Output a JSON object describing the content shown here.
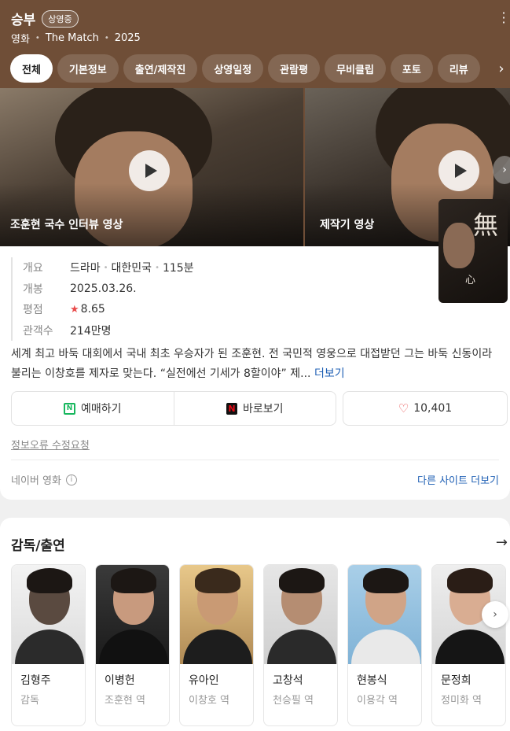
{
  "header": {
    "title": "승부",
    "badge": "상영중",
    "meta": [
      "영화",
      "The Match",
      "2025"
    ],
    "bg_color": "#6f4e37"
  },
  "tabs": [
    {
      "label": "전체",
      "active": true
    },
    {
      "label": "기본정보",
      "active": false
    },
    {
      "label": "출연/제작진",
      "active": false
    },
    {
      "label": "상영일정",
      "active": false
    },
    {
      "label": "관람평",
      "active": false
    },
    {
      "label": "무비클립",
      "active": false
    },
    {
      "label": "포토",
      "active": false
    },
    {
      "label": "리뷰",
      "active": false
    }
  ],
  "videos": [
    {
      "caption": "조훈현 국수 인터뷰 영상",
      "icon": "play-icon"
    },
    {
      "caption": "제작기 영상",
      "icon": "play-icon"
    }
  ],
  "info": {
    "summary_label": "개요",
    "genre": "드라마",
    "country": "대한민국",
    "runtime": "115분",
    "release_label": "개봉",
    "release_date": "2025.03.26.",
    "rating_label": "평점",
    "rating": "8.65",
    "audience_label": "관객수",
    "audience": "214만명"
  },
  "synopsis": {
    "text": "세계 최고 바둑 대회에서 국내 최초 우승자가 된 조훈현. 전 국민적 영웅으로 대접받던 그는 바둑 신동이라 불리는 이창호를 제자로 맞는다. “실전에선 기세가 8할이야” 제...",
    "more_label": "더보기"
  },
  "actions": {
    "reserve_label": "예매하기",
    "watch_label": "바로보기",
    "likes": "10,401"
  },
  "footer": {
    "report_label": "정보오류 수정요청",
    "source_label": "네이버 영화",
    "other_sites_label": "다른 사이트 더보기"
  },
  "cast": {
    "title": "감독/출연",
    "people": [
      {
        "name": "김형주",
        "role": "감독"
      },
      {
        "name": "이병헌",
        "role": "조훈현 역"
      },
      {
        "name": "유아인",
        "role": "이창호 역"
      },
      {
        "name": "고창석",
        "role": "천승필 역"
      },
      {
        "name": "현봉식",
        "role": "이용각 역"
      },
      {
        "name": "문정희",
        "role": "정미화 역"
      }
    ]
  },
  "colors": {
    "accent_link": "#1e5fb4",
    "star": "#e94b4b",
    "naver_green": "#18b75e",
    "netflix_red": "#e50914"
  }
}
